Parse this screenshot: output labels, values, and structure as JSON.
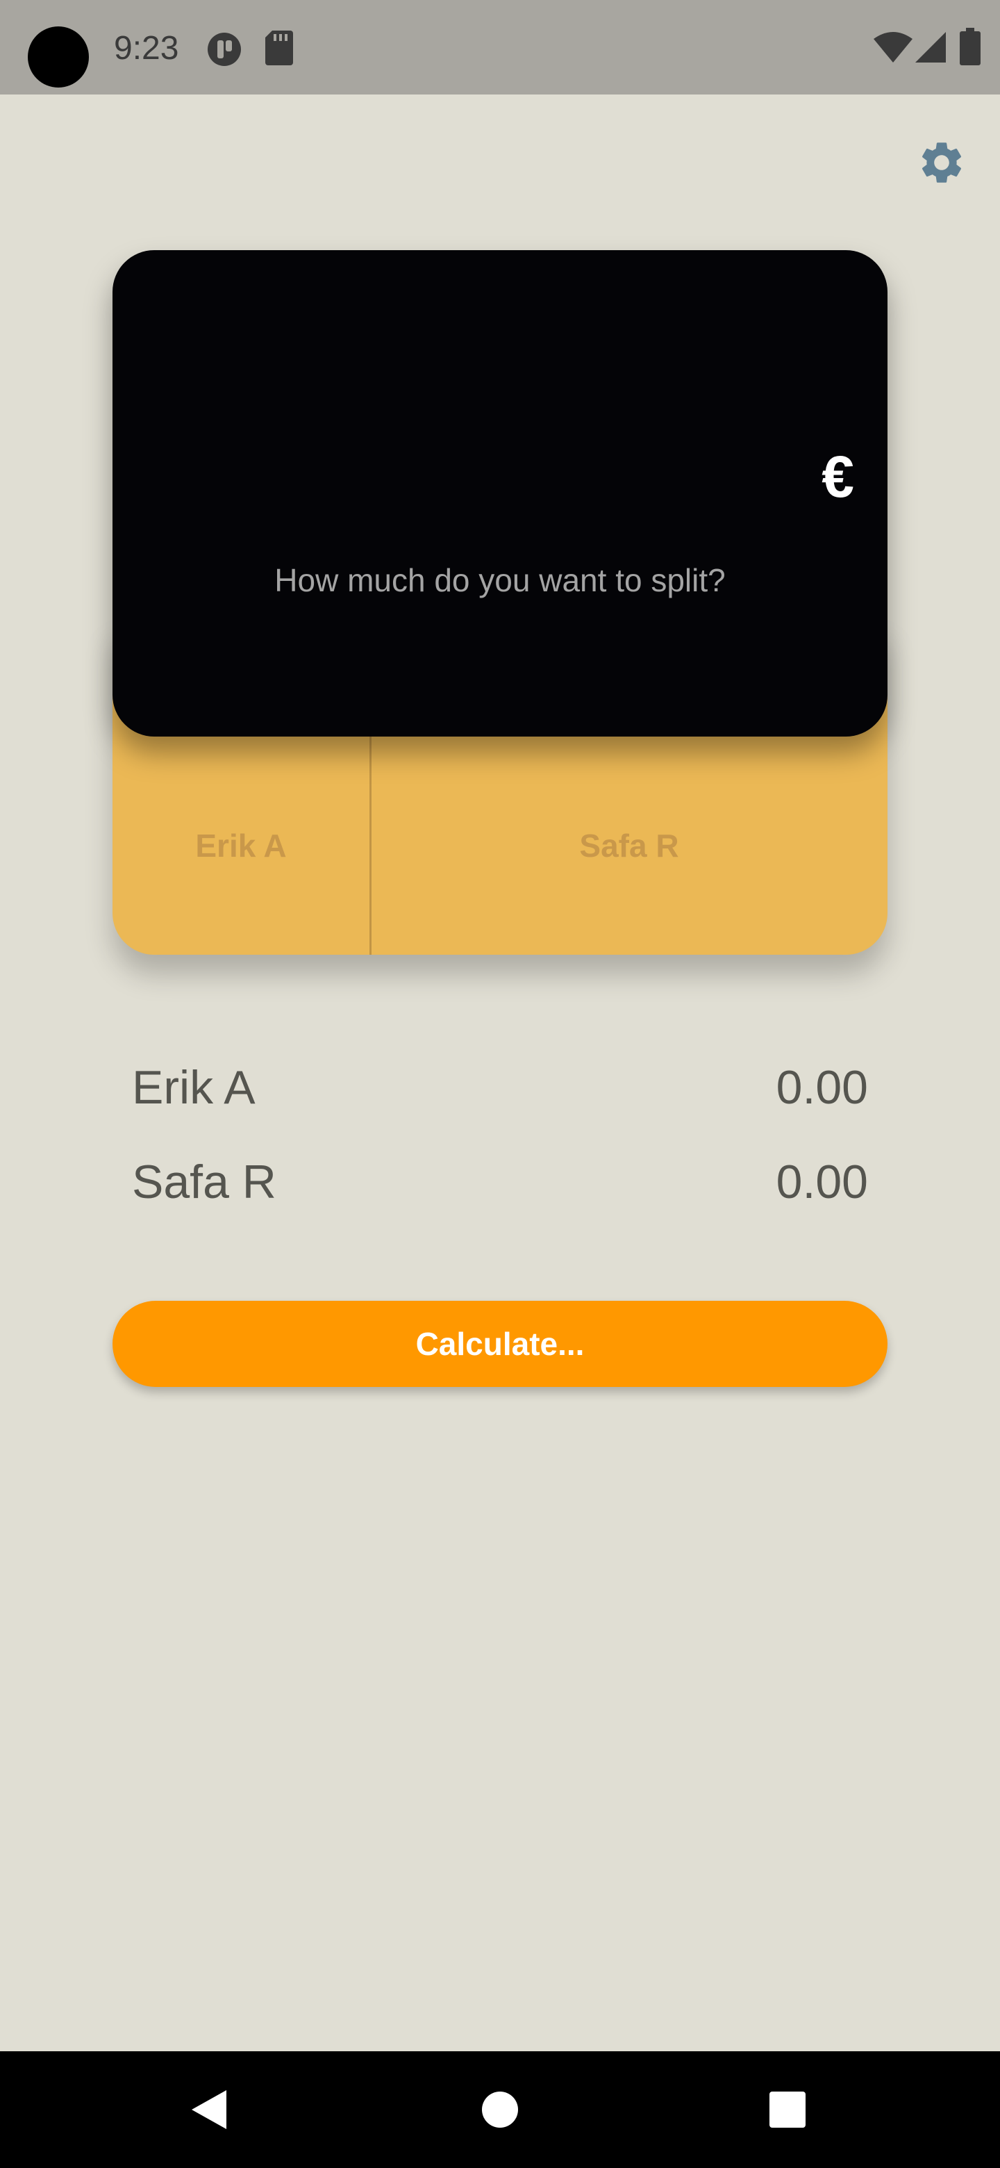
{
  "status_bar": {
    "time": "9:23"
  },
  "icons": {
    "settings": "gear-icon",
    "currency": "euro-icon"
  },
  "amount_card": {
    "currency_symbol": "€",
    "placeholder": "How much do you want to split?"
  },
  "split": {
    "parts": [
      {
        "label": "Erik A"
      },
      {
        "label": "Safa R"
      }
    ]
  },
  "results": [
    {
      "name": "Erik A",
      "amount": "0.00"
    },
    {
      "name": "Safa R",
      "amount": "0.00"
    }
  ],
  "calculate_label": "Calculate...",
  "colors": {
    "background": "#e0ded3",
    "card": "#040407",
    "split_bar": "#ebb855",
    "accent": "#ff9800",
    "settings_icon": "#5f7f93"
  }
}
